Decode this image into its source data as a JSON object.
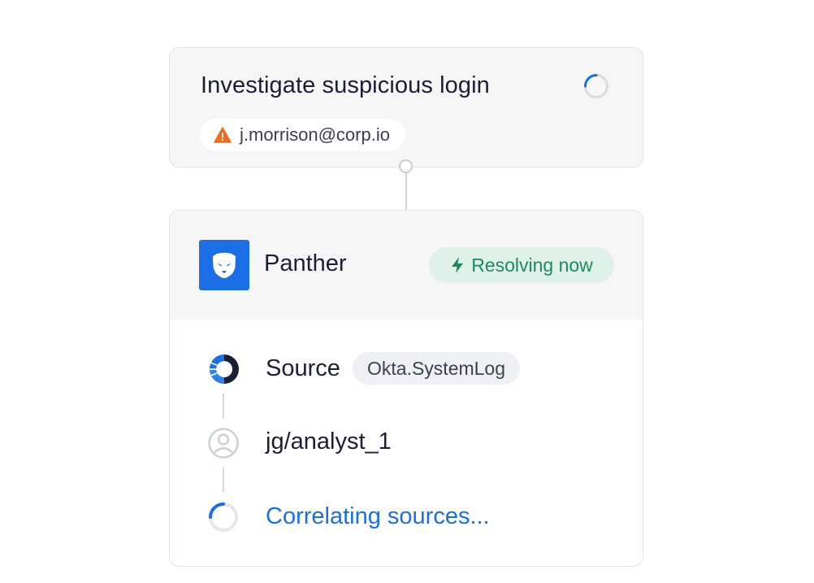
{
  "task": {
    "title": "Investigate suspicious login",
    "spinner_icon": "loading-spinner-icon",
    "user": {
      "icon": "warning-icon",
      "email": "j.morrison@corp.io"
    }
  },
  "integration": {
    "logo_icon": "panther-logo-icon",
    "name": "Panther",
    "status": {
      "icon": "lightning-bolt-icon",
      "label": "Resolving now"
    },
    "steps": [
      {
        "icon": "okta-icon",
        "label": "Source",
        "tag": "Okta.SystemLog"
      },
      {
        "icon": "user-circle-icon",
        "label": "jg/analyst_1"
      },
      {
        "icon": "loading-spinner-icon",
        "label": "Correlating sources..."
      }
    ]
  },
  "colors": {
    "accent": "#1b6fe6",
    "warning": "#f26b1d",
    "success_text": "#1e8a5c",
    "success_bg": "#def2ea",
    "card_header_bg": "#f6f6f7"
  }
}
